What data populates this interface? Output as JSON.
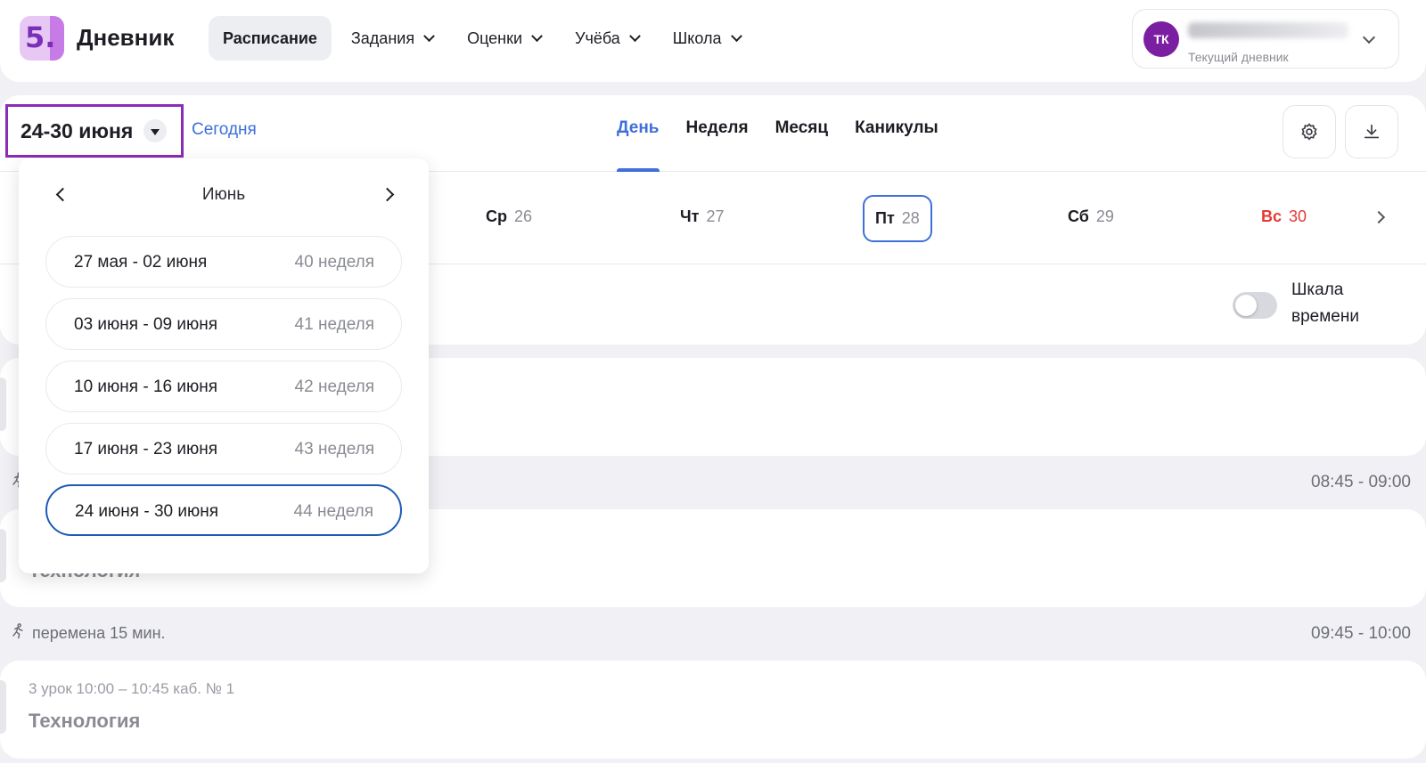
{
  "header": {
    "logo_text": "5.",
    "brand": "Дневник",
    "nav": [
      {
        "label": "Расписание",
        "active": true
      },
      {
        "label": "Задания"
      },
      {
        "label": "Оценки"
      },
      {
        "label": "Учёба"
      },
      {
        "label": "Школа"
      }
    ],
    "profile": {
      "initials": "ТК",
      "subtitle": "Текущий дневник"
    }
  },
  "toolbar": {
    "range": "24-30 июня",
    "today": "Сегодня",
    "views": [
      "День",
      "Неделя",
      "Месяц",
      "Каникулы"
    ],
    "active_view": "День",
    "settings_icon": "gear-icon",
    "download_icon": "download-icon"
  },
  "days": [
    {
      "name": "Ср",
      "num": "26"
    },
    {
      "name": "Чт",
      "num": "27"
    },
    {
      "name": "Пт",
      "num": "28",
      "selected": true
    },
    {
      "name": "Сб",
      "num": "29"
    },
    {
      "name": "Вс",
      "num": "30",
      "weekend": true
    }
  ],
  "scale": {
    "label": "Шкала времени",
    "enabled": false
  },
  "breaks": [
    {
      "time": "08:45 - 09:00"
    },
    {
      "text": "перемена 15 мин.",
      "time": "09:45 - 10:00"
    }
  ],
  "lessons": [
    {
      "subject": "Технология"
    },
    {
      "meta": "3 урок 10:00 – 10:45 каб. № 1",
      "subject": "Технология"
    }
  ],
  "dropdown": {
    "month": "Июнь",
    "weeks": [
      {
        "range": "27 мая - 02 июня",
        "week": "40 неделя"
      },
      {
        "range": "03 июня - 09 июня",
        "week": "41 неделя"
      },
      {
        "range": "10 июня - 16 июня",
        "week": "42 неделя"
      },
      {
        "range": "17 июня - 23 июня",
        "week": "43 неделя"
      },
      {
        "range": "24 июня - 30 июня",
        "week": "44 неделя",
        "selected": true
      }
    ]
  },
  "colors": {
    "accent": "#3f6fd8",
    "highlight_border": "#8c2bb5",
    "avatar": "#7b1fa2",
    "weekend": "#e53935"
  }
}
